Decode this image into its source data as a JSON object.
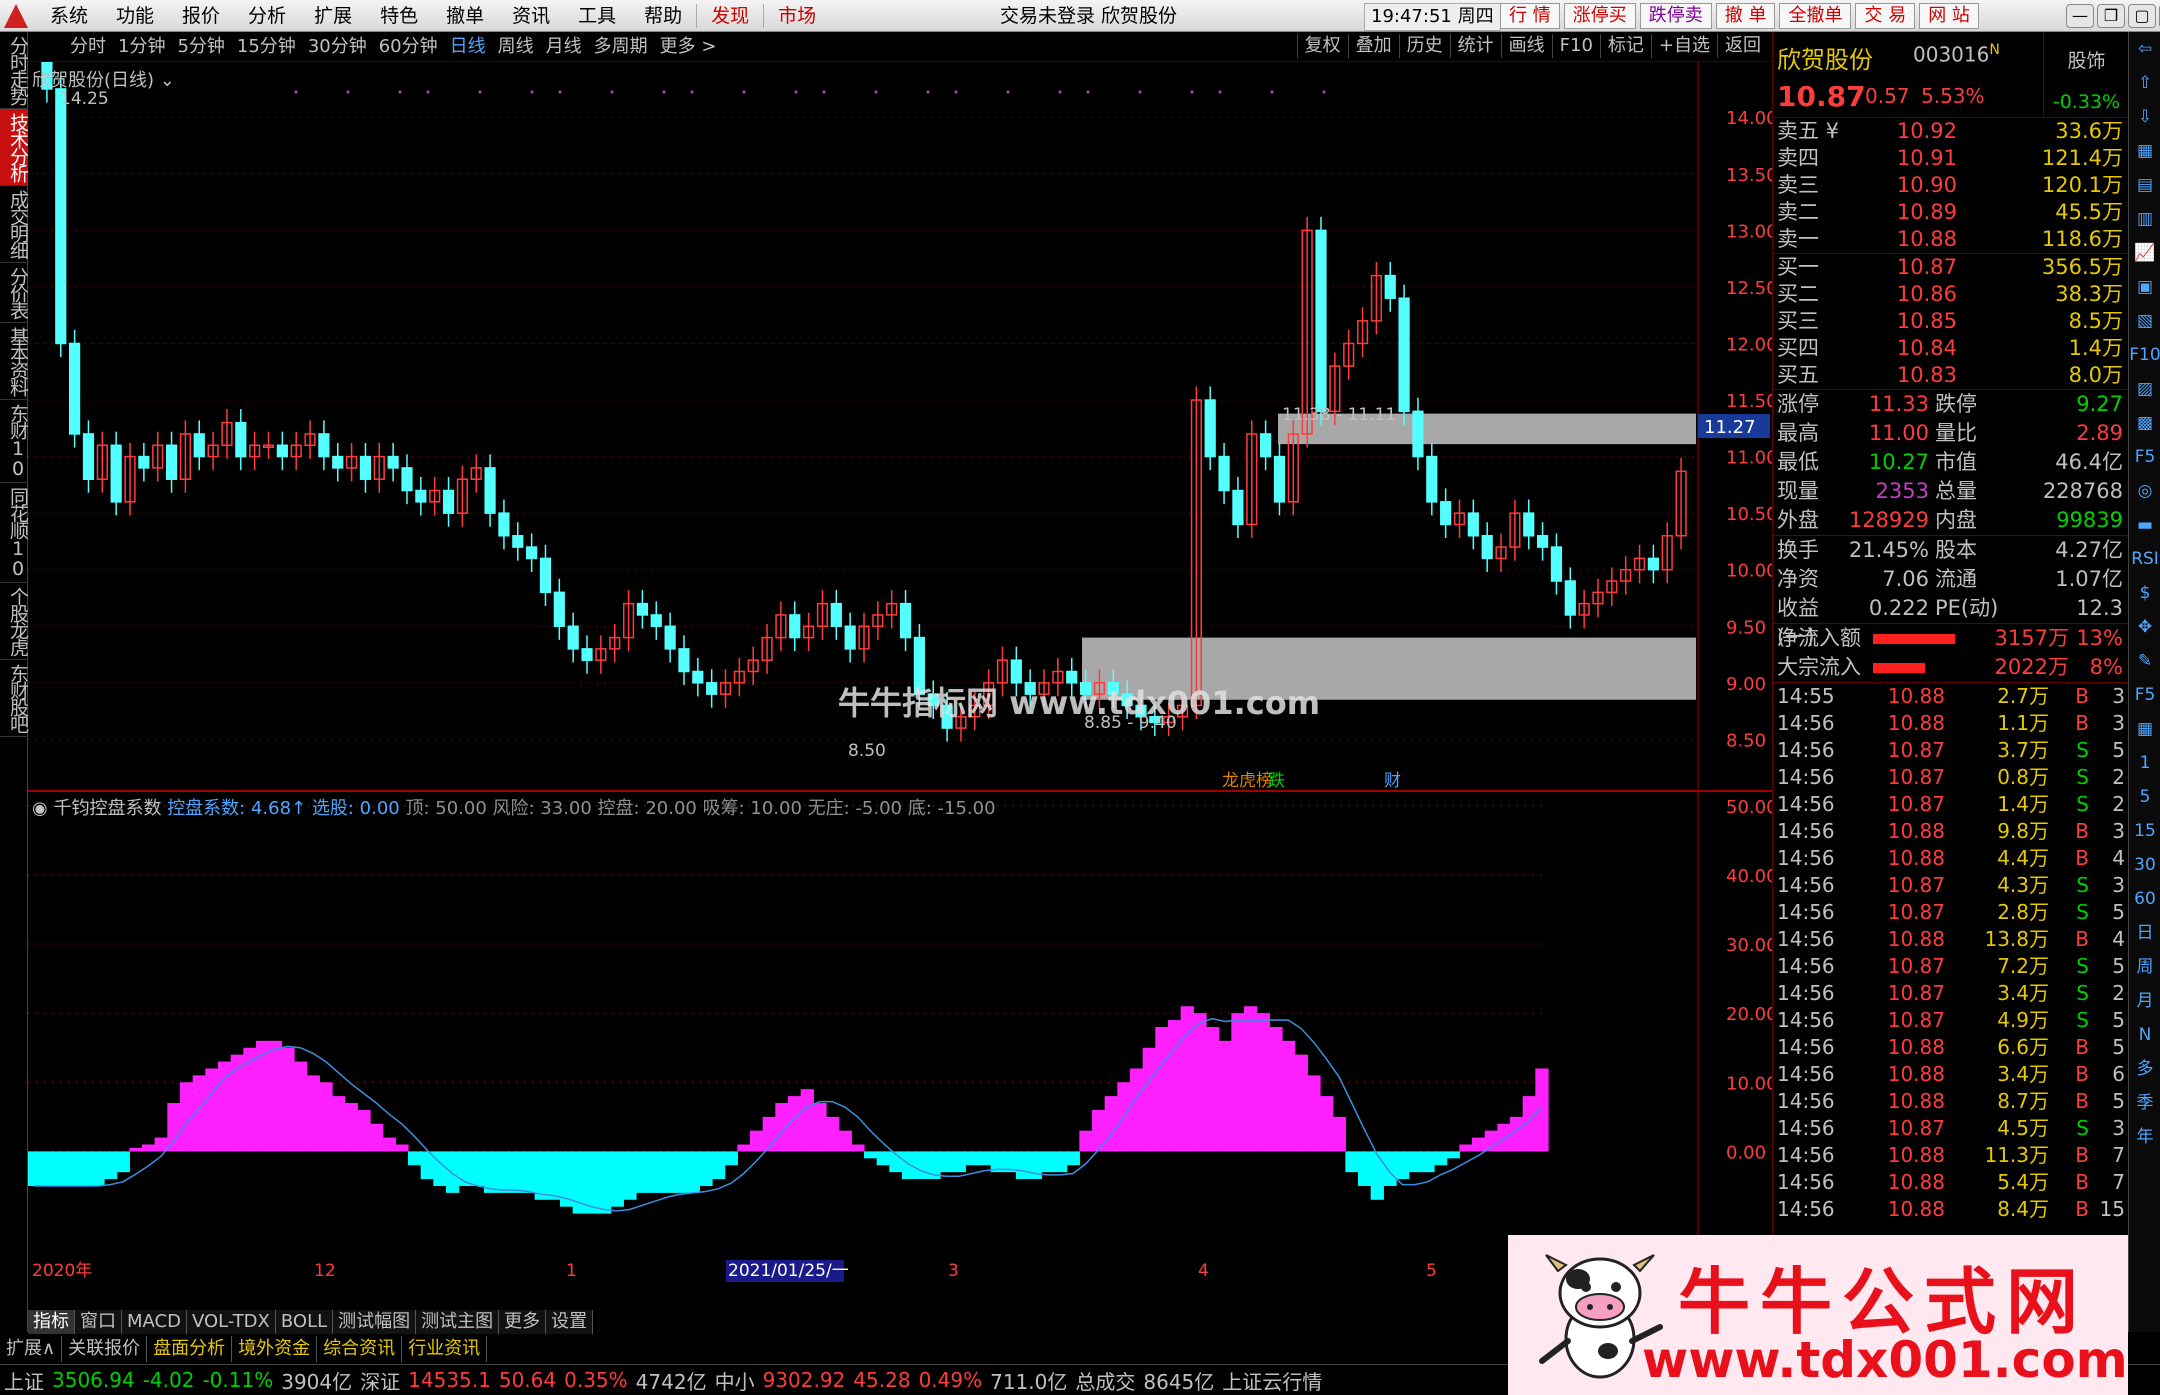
{
  "menu": {
    "items": [
      "系统",
      "功能",
      "报价",
      "分析",
      "扩展",
      "特色",
      "撤单",
      "资讯",
      "工具",
      "帮助"
    ],
    "red_items": [
      "发现",
      "市场"
    ],
    "center_title": "交易未登录  欣贺股份",
    "clock": "19:47:51 周四",
    "right_buttons": [
      "行 情",
      "涨停买",
      "跌停卖",
      "撤 单",
      "全撤单",
      "交 易",
      "网 站"
    ],
    "window_buttons": [
      "—",
      "❐",
      "▢",
      "✕"
    ]
  },
  "left_tabs": [
    "分时走势",
    "技术分析",
    "成交明细",
    "分价表",
    "基本资料",
    "东财10",
    "同花顺10",
    "个股龙虎",
    "东财股吧"
  ],
  "left_tabs_active": 1,
  "period_bar": {
    "items": [
      "分时",
      "1分钟",
      "5分钟",
      "15分钟",
      "30分钟",
      "60分钟",
      "日线",
      "周线",
      "月线",
      "多周期",
      "更多 >"
    ],
    "selected": "日线",
    "tools": [
      "复权",
      "叠加",
      "历史",
      "统计",
      "画线",
      "F10",
      "标记",
      "+自选",
      "返回"
    ]
  },
  "chart_title": "欣贺股份(日线)",
  "indicator_title": {
    "name": "千钧控盘系数",
    "k1": "控盘系数: 4.68↑",
    "k2": "选股: 0.00",
    "params": "顶: 50.00  风险: 33.00  控盘: 20.00  吸筹: 10.00  无庄: -5.00  底: -15.00"
  },
  "chart_data": [
    {
      "type": "candlestick",
      "title": "欣贺股份(日线)",
      "y_ticks": [
        14.0,
        13.5,
        13.0,
        12.5,
        12.0,
        11.5,
        11.0,
        10.5,
        10.0,
        9.5,
        9.0,
        8.5
      ],
      "ylim": [
        8.3,
        14.4
      ],
      "annotations": [
        "14.25",
        "8.50",
        "11.38 - 11.11",
        "8.85 - 9.40"
      ],
      "current_price_tag": "11.27",
      "zones": [
        [
          11.11,
          11.38
        ],
        [
          8.85,
          9.4
        ]
      ],
      "event_labels": [
        "龙虎榜",
        "跌",
        "财"
      ],
      "x_labels": [
        "2020年",
        "12",
        "1",
        "2021/01/25/一",
        "3",
        "4",
        "5"
      ],
      "closes": [
        14.25,
        12.0,
        11.2,
        10.8,
        11.1,
        10.6,
        11.0,
        10.9,
        11.1,
        10.8,
        11.2,
        11.0,
        11.1,
        11.3,
        11.0,
        11.1,
        11.1,
        11.0,
        11.1,
        11.2,
        11.0,
        10.9,
        11.0,
        10.8,
        11.0,
        10.9,
        10.7,
        10.6,
        10.7,
        10.5,
        10.8,
        10.9,
        10.5,
        10.3,
        10.2,
        10.1,
        9.8,
        9.5,
        9.3,
        9.2,
        9.3,
        9.4,
        9.7,
        9.6,
        9.5,
        9.3,
        9.1,
        9.0,
        8.9,
        9.0,
        9.1,
        9.2,
        9.4,
        9.6,
        9.4,
        9.5,
        9.7,
        9.5,
        9.3,
        9.5,
        9.6,
        9.7,
        9.4,
        8.9,
        8.8,
        8.6,
        8.7,
        8.8,
        9.0,
        9.2,
        9.0,
        8.9,
        9.0,
        9.1,
        9.0,
        8.9,
        9.0,
        8.9,
        8.8,
        8.7,
        8.65,
        8.7,
        8.8,
        11.5,
        11.0,
        10.7,
        10.4,
        11.2,
        11.0,
        10.6,
        11.2,
        13.0,
        11.4,
        11.8,
        12.0,
        12.2,
        12.6,
        12.4,
        11.4,
        11.0,
        10.6,
        10.4,
        10.5,
        10.3,
        10.1,
        10.2,
        10.5,
        10.3,
        10.2,
        9.9,
        9.6,
        9.7,
        9.8,
        9.9,
        10.0,
        10.1,
        10.0,
        10.3,
        10.87
      ]
    },
    {
      "type": "bar",
      "title": "千钧控盘系数",
      "y_ticks": [
        50.0,
        40.0,
        30.0,
        20.0,
        10.0,
        0.0
      ],
      "ylim": [
        -16,
        52
      ],
      "series": [
        {
          "name": "控盘系数",
          "values": [
            -5,
            -5,
            -5,
            -5,
            -5,
            -5,
            -4,
            -3,
            0.5,
            1,
            2,
            7,
            10,
            11,
            12,
            13,
            14,
            15,
            16,
            16,
            15,
            13,
            11,
            10,
            8,
            7,
            6,
            4,
            2,
            1,
            -2,
            -4,
            -5,
            -6,
            -5,
            -5,
            -6,
            -6,
            -6,
            -6,
            -7,
            -7,
            -8,
            -9,
            -9,
            -9,
            -8,
            -7,
            -6,
            -6,
            -6,
            -6,
            -6,
            -5,
            -4,
            -2,
            1,
            3,
            5,
            7,
            8,
            9,
            7,
            5,
            3,
            1,
            -1,
            -2,
            -3,
            -4,
            -4,
            -4,
            -3,
            -3,
            -2,
            -2,
            -3,
            -3,
            -4,
            -4,
            -3,
            -3,
            -2,
            3,
            6,
            8,
            10,
            12,
            15,
            18,
            19,
            21,
            20,
            18,
            16,
            20,
            21,
            20,
            18,
            16,
            14,
            11,
            8,
            5,
            -3,
            -5,
            -7,
            -5,
            -4,
            -3,
            -3,
            -2,
            -1,
            1,
            2,
            3,
            4,
            5,
            8,
            12
          ]
        }
      ]
    }
  ],
  "quote": {
    "name": "欣贺股份",
    "code": "003016",
    "code_flag": "N",
    "price": "10.87",
    "change": "0.57",
    "pct": "5.53%",
    "box_label": "股饰",
    "box_value": "-0.33%",
    "sells": [
      {
        "label": "卖五 ¥",
        "price": "10.92",
        "vol": "33.6万"
      },
      {
        "label": "卖四",
        "price": "10.91",
        "vol": "121.4万"
      },
      {
        "label": "卖三",
        "price": "10.90",
        "vol": "120.1万"
      },
      {
        "label": "卖二",
        "price": "10.89",
        "vol": "45.5万"
      },
      {
        "label": "卖一",
        "price": "10.88",
        "vol": "118.6万"
      }
    ],
    "buys": [
      {
        "label": "买一",
        "price": "10.87",
        "vol": "356.5万"
      },
      {
        "label": "买二",
        "price": "10.86",
        "vol": "38.3万"
      },
      {
        "label": "买三",
        "price": "10.85",
        "vol": "8.5万"
      },
      {
        "label": "买四",
        "price": "10.84",
        "vol": "1.4万"
      },
      {
        "label": "买五",
        "price": "10.83",
        "vol": "8.0万"
      }
    ],
    "stats": [
      {
        "k1": "涨停",
        "v1": "11.33",
        "c1": "#ff3c3c",
        "k2": "跌停",
        "v2": "9.27",
        "c2": "#00d000"
      },
      {
        "k1": "最高",
        "v1": "11.00",
        "c1": "#ff3c3c",
        "k2": "量比",
        "v2": "2.89",
        "c2": "#ff3c3c"
      },
      {
        "k1": "最低",
        "v1": "10.27",
        "c1": "#00d000",
        "k2": "市值",
        "v2": "46.4亿",
        "c2": "#c0c0c0"
      },
      {
        "k1": "现量",
        "v1": "2353",
        "c1": "#c040c0",
        "k2": "总量",
        "v2": "228768",
        "c2": "#c0c0c0"
      },
      {
        "k1": "外盘",
        "v1": "128929",
        "c1": "#ff3c3c",
        "k2": "内盘",
        "v2": "99839",
        "c2": "#00d000"
      }
    ],
    "stats2": [
      {
        "k1": "换手",
        "v1": "21.45%",
        "c1": "#c0c0c0",
        "k2": "股本",
        "v2": "4.27亿",
        "c2": "#c0c0c0"
      },
      {
        "k1": "净资",
        "v1": "7.06",
        "c1": "#c0c0c0",
        "k2": "流通",
        "v2": "1.07亿",
        "c2": "#c0c0c0"
      },
      {
        "k1": "收益(一)",
        "v1": "0.222",
        "c1": "#c0c0c0",
        "k2": "PE(动)",
        "v2": "12.3",
        "c2": "#c0c0c0"
      }
    ],
    "flows": [
      {
        "label": "净流入额",
        "bar_fraction": 0.82,
        "value": "3157万",
        "pct": "13%"
      },
      {
        "label": "大宗流入",
        "bar_fraction": 0.52,
        "value": "2022万",
        "pct": "8%"
      }
    ],
    "ticks": [
      {
        "t": "14:55",
        "p": "10.88",
        "q": "2.7万",
        "s": "B",
        "n": "3"
      },
      {
        "t": "14:56",
        "p": "10.88",
        "q": "1.1万",
        "s": "B",
        "n": "3"
      },
      {
        "t": "14:56",
        "p": "10.87",
        "q": "3.7万",
        "s": "S",
        "n": "5"
      },
      {
        "t": "14:56",
        "p": "10.87",
        "q": "0.8万",
        "s": "S",
        "n": "2"
      },
      {
        "t": "14:56",
        "p": "10.87",
        "q": "1.4万",
        "s": "S",
        "n": "2"
      },
      {
        "t": "14:56",
        "p": "10.88",
        "q": "9.8万",
        "s": "B",
        "n": "3"
      },
      {
        "t": "14:56",
        "p": "10.88",
        "q": "4.4万",
        "s": "B",
        "n": "4"
      },
      {
        "t": "14:56",
        "p": "10.87",
        "q": "4.3万",
        "s": "S",
        "n": "3"
      },
      {
        "t": "14:56",
        "p": "10.87",
        "q": "2.8万",
        "s": "S",
        "n": "5"
      },
      {
        "t": "14:56",
        "p": "10.88",
        "q": "13.8万",
        "s": "B",
        "n": "4"
      },
      {
        "t": "14:56",
        "p": "10.87",
        "q": "7.2万",
        "s": "S",
        "n": "5"
      },
      {
        "t": "14:56",
        "p": "10.87",
        "q": "3.4万",
        "s": "S",
        "n": "2"
      },
      {
        "t": "14:56",
        "p": "10.87",
        "q": "4.9万",
        "s": "S",
        "n": "5"
      },
      {
        "t": "14:56",
        "p": "10.88",
        "q": "6.6万",
        "s": "B",
        "n": "5"
      },
      {
        "t": "14:56",
        "p": "10.88",
        "q": "3.4万",
        "s": "B",
        "n": "6"
      },
      {
        "t": "14:56",
        "p": "10.88",
        "q": "8.7万",
        "s": "B",
        "n": "5"
      },
      {
        "t": "14:56",
        "p": "10.87",
        "q": "4.5万",
        "s": "S",
        "n": "3"
      },
      {
        "t": "14:56",
        "p": "10.88",
        "q": "11.3万",
        "s": "B",
        "n": "7"
      },
      {
        "t": "14:56",
        "p": "10.88",
        "q": "5.4万",
        "s": "B",
        "n": "7"
      },
      {
        "t": "14:56",
        "p": "10.88",
        "q": "8.4万",
        "s": "B",
        "n": "15"
      }
    ]
  },
  "bottom_tabs": [
    "指标",
    "窗口",
    "MACD",
    "VOL-TDX",
    "BOLL",
    "测试幅图",
    "测试主图",
    "更多",
    "设置"
  ],
  "toolbar2": [
    "扩展∧",
    "关联报价",
    "盘面分析",
    "境外资金",
    "综合资讯",
    "行业资讯"
  ],
  "status": {
    "sh_label": "上证",
    "sh_val": "3506.94",
    "sh_chg": "-4.02",
    "sh_pct": "-0.11%",
    "sh_amt": "3904亿",
    "sz_label": "深证",
    "sz_val": "14535.1",
    "sz_chg": "50.64",
    "sz_pct": "0.35%",
    "sz_amt": "4742亿",
    "zx_label": "中小",
    "zx_val": "9302.92",
    "zx_chg": "45.28",
    "zx_pct": "0.49%",
    "zx_amt": "711.0亿",
    "total_label": "总成交",
    "total_val": "8645亿",
    "cloud": "上证云行情"
  },
  "icon_strip": [
    "⇦",
    "⇧",
    "⇩",
    "▦",
    "▤",
    "▥",
    "📈",
    "▣",
    "▧",
    "F10",
    "▨",
    "▩",
    "F5",
    "◎",
    "▬",
    "RSI",
    "$",
    "✥",
    "✎",
    "F5",
    "▦",
    "1",
    "5",
    "15",
    "30",
    "60",
    "日",
    "周",
    "月",
    "N",
    "多",
    "季",
    "年"
  ],
  "watermark": {
    "title": "牛牛公式网",
    "url": "www.tdx001.com",
    "mid": "牛牛指标网 www.tdx001.com"
  },
  "colors": {
    "up": "#ff3c3c",
    "down": "#54ffff",
    "pos": "#ff20ff",
    "neg": "#00ffff",
    "line": "#3a8fe0",
    "zone": "#a8a8a8"
  }
}
